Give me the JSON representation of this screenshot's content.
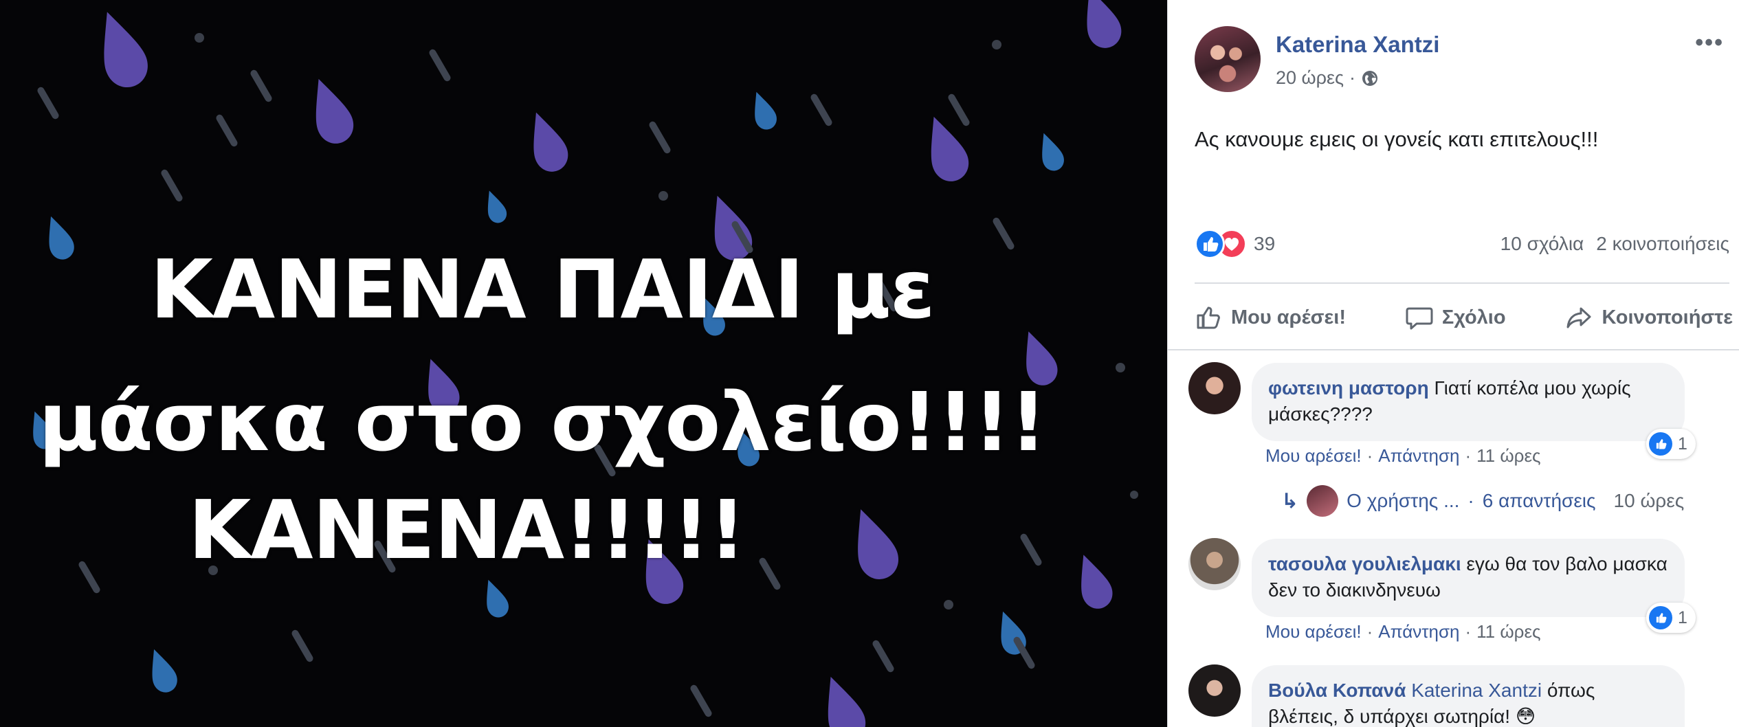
{
  "image": {
    "overlay_lines": [
      "ΚΑΝΕΝΑ ΠΑΙΔΙ με",
      "μάσκα στο σχολείο!!!!",
      "ΚΑΝΕΝΑ!!!!!"
    ],
    "drop_colors": {
      "purple": "#5b4aa8",
      "blue": "#2f6fb0",
      "grey": "#444a55"
    }
  },
  "post": {
    "author": "Katerina Xantzi",
    "time": "20 ώρες",
    "separator": "·",
    "privacy_icon": "globe-icon",
    "more_icon": "•••",
    "text": "Ας κανουμε εμεις οι γονείς κατι επιτελους!!!",
    "reaction_count": "39",
    "comments_count": "10 σχόλια",
    "shares_count": "2 κοινοποιήσεις",
    "actions": {
      "like": "Μου αρέσει!",
      "comment": "Σχόλιο",
      "share": "Κοινοποιήστε"
    }
  },
  "comments": [
    {
      "author": "φωτεινη μαστορη",
      "text": "Γιατί κοπέλα μου χωρίς μάσκες????",
      "like_label": "Μου αρέσει!",
      "reply_label": "Απάντηση",
      "time": "11 ώρες",
      "likes": "1"
    },
    {
      "author": "τασουλα γουλιελμακι",
      "text": "εγω θα τον βαλο μασκα δεν το διακινδηνευω",
      "like_label": "Μου αρέσει!",
      "reply_label": "Απάντηση",
      "time": "11 ώρες",
      "likes": "1"
    },
    {
      "author": "Βούλα Κοπανά",
      "mention": "Katerina Xantzi",
      "text": "όπως βλέπεις, δ υπάρχει σωτηρία! 😳"
    }
  ],
  "replies": {
    "user": "Ο χρήστης ...",
    "separator": "·",
    "count": "6 απαντήσεις",
    "time": "10 ώρες"
  },
  "colors": {
    "link": "#385898",
    "meta": "#606770",
    "like_blue": "#1877f2",
    "love_red": "#f33e58",
    "bubble": "#f2f3f5"
  }
}
